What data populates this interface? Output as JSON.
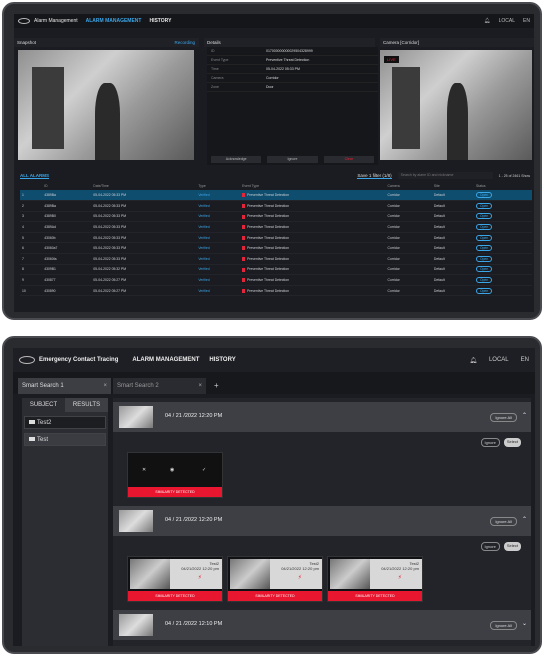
{
  "top": {
    "header": {
      "title": "Alarm Management",
      "nav_alarm": "ALARM MANAGEMENT",
      "nav_history": "HISTORY",
      "local": "LOCAL",
      "lang": "EN"
    },
    "snapshot": {
      "title": "Snapshot",
      "status": "Recording"
    },
    "details": {
      "title": "Details",
      "rows": [
        {
          "k": "ID",
          "v": "017000000000029504328999"
        },
        {
          "k": "Event Type",
          "v": "Preventive Threat Detection"
        },
        {
          "k": "Time",
          "v": "05-04-2022 05:33 PM"
        },
        {
          "k": "Camera",
          "v": "Corridor"
        },
        {
          "k": "Zone",
          "v": "Door"
        }
      ],
      "btn_ack": "Acknowledge",
      "btn_ignore": "Ignore",
      "btn_false": "Clear"
    },
    "camera": {
      "title": "Camera [Corridor]",
      "live": "LIVE"
    },
    "toolbar": {
      "all_alarms": "ALL ALARMS",
      "save_filter": "Save 1 filter (1/8)",
      "search_placeholder": "Search by alarm ID and nickname",
      "pager": "1 - 25 of 2461   Show"
    },
    "table": {
      "headers": [
        "",
        "ID",
        "Date/Time",
        "Type",
        "Event Type",
        "Camera",
        "Site",
        "Status"
      ],
      "rows": [
        [
          "1",
          "4389Ba",
          "05-04-2022 05:33 PM",
          "Verified",
          "Preventive Threat Detection",
          "Corridor",
          "Default",
          "Open"
        ],
        [
          "2",
          "4389Ba",
          "05-04-2022 05:33 PM",
          "Verified",
          "Preventive Threat Detection",
          "Corridor",
          "Default",
          "Open"
        ],
        [
          "3",
          "4389B0",
          "05-04-2022 05:33 PM",
          "Verified",
          "Preventive Threat Detection",
          "Corridor",
          "Default",
          "Open"
        ],
        [
          "4",
          "4389Ad",
          "05-04-2022 05:33 PM",
          "Verified",
          "Preventive Threat Detection",
          "Corridor",
          "Default",
          "Open"
        ],
        [
          "5",
          "43060b",
          "05-04-2022 05:33 PM",
          "Verified",
          "Preventive Threat Detection",
          "Corridor",
          "Default",
          "Open"
        ],
        [
          "6",
          "43060a7",
          "05-04-2022 05:33 PM",
          "Verified",
          "Preventive Threat Detection",
          "Corridor",
          "Default",
          "Open"
        ],
        [
          "7",
          "43060fa",
          "05-04-2022 05:33 PM",
          "Verified",
          "Preventive Threat Detection",
          "Corridor",
          "Default",
          "Open"
        ],
        [
          "8",
          "4309B1",
          "05-04-2022 05:32 PM",
          "Verified",
          "Preventive Threat Detection",
          "Corridor",
          "Default",
          "Open"
        ],
        [
          "9",
          "430877",
          "05-04-2022 05:27 PM",
          "Verified",
          "Preventive Threat Detection",
          "Corridor",
          "Default",
          "Open"
        ],
        [
          "10",
          "430890",
          "05-04-2022 05:27 PM",
          "Verified",
          "Preventive Threat Detection",
          "Corridor",
          "Default",
          "Open"
        ]
      ]
    }
  },
  "bottom": {
    "header": {
      "title": "Emergency Contact Tracing",
      "nav_alarm": "ALARM MANAGEMENT",
      "nav_history": "HISTORY",
      "local": "LOCAL",
      "lang": "EN"
    },
    "tabs": [
      "Smart Search 1",
      "Smart Search 2"
    ],
    "side": {
      "subject": "SUBJECT",
      "results": "RESULTS",
      "items": [
        "Test2",
        "Test"
      ]
    },
    "groups": [
      {
        "date": "04 / 21 /2022 12:20 PM",
        "ignore_all": "Ignore All",
        "ignore": "Ignore",
        "select": "Select"
      },
      {
        "date": "04 / 21 /2022 12:20 PM",
        "ignore_all": "Ignore All",
        "ignore": "Ignore",
        "select": "Select"
      },
      {
        "date": "04 / 21 /2022 12:10 PM",
        "ignore_all": "Ignore All"
      }
    ],
    "cards": [
      {
        "label": "SIMILARITY DETECTED"
      },
      {
        "label": "SIMILARITY DETECTED",
        "name": "Test2",
        "time": "04/21/2022 12:20 pm"
      },
      {
        "label": "SIMILARITY DETECTED",
        "name": "Test2",
        "time": "04/21/2022 12:20 pm"
      },
      {
        "label": "SIMILARITY DETECTED",
        "name": "Test2",
        "time": "04/21/2022 12:20 pm"
      }
    ]
  },
  "colors": {
    "accent": "#3aa6e8",
    "alert": "#e8162f",
    "bg": "#1b1c21"
  }
}
